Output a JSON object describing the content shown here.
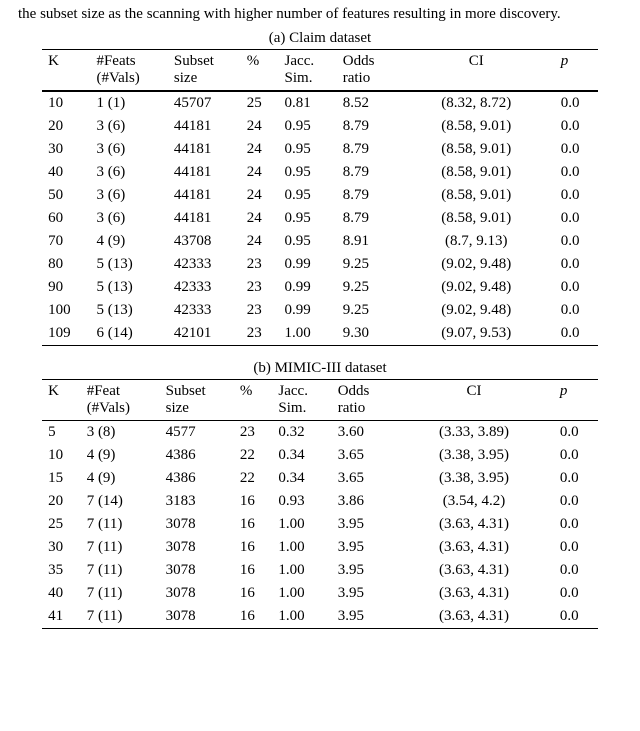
{
  "fragment": "the subset size as the scanning with higher number of features resulting in more discovery.",
  "tableA": {
    "caption": "(a) Claim dataset",
    "headers": {
      "k": "K",
      "feats1": "#Feats",
      "feats2": "(#Vals)",
      "subset1": "Subset",
      "subset2": "size",
      "pct": "%",
      "jacc1": "Jacc.",
      "jacc2": "Sim.",
      "odds1": "Odds",
      "odds2": "ratio",
      "ci": "CI",
      "p": "p"
    },
    "rows": [
      {
        "k": "10",
        "feats": "1 (1)",
        "subset": "45707",
        "pct": "25",
        "jacc": "0.81",
        "odds": "8.52",
        "ci": "(8.32, 8.72)",
        "p": "0.0"
      },
      {
        "k": "20",
        "feats": "3 (6)",
        "subset": "44181",
        "pct": "24",
        "jacc": "0.95",
        "odds": "8.79",
        "ci": "(8.58, 9.01)",
        "p": "0.0"
      },
      {
        "k": "30",
        "feats": "3 (6)",
        "subset": "44181",
        "pct": "24",
        "jacc": "0.95",
        "odds": "8.79",
        "ci": "(8.58, 9.01)",
        "p": "0.0"
      },
      {
        "k": "40",
        "feats": "3 (6)",
        "subset": "44181",
        "pct": "24",
        "jacc": "0.95",
        "odds": "8.79",
        "ci": "(8.58, 9.01)",
        "p": "0.0"
      },
      {
        "k": "50",
        "feats": "3 (6)",
        "subset": "44181",
        "pct": "24",
        "jacc": "0.95",
        "odds": "8.79",
        "ci": "(8.58, 9.01)",
        "p": "0.0"
      },
      {
        "k": "60",
        "feats": "3 (6)",
        "subset": "44181",
        "pct": "24",
        "jacc": "0.95",
        "odds": "8.79",
        "ci": "(8.58, 9.01)",
        "p": "0.0"
      },
      {
        "k": "70",
        "feats": "4 (9)",
        "subset": "43708",
        "pct": "24",
        "jacc": "0.95",
        "odds": "8.91",
        "ci": "(8.7, 9.13)",
        "p": "0.0"
      },
      {
        "k": "80",
        "feats": "5 (13)",
        "subset": "42333",
        "pct": "23",
        "jacc": "0.99",
        "odds": "9.25",
        "ci": "(9.02, 9.48)",
        "p": "0.0"
      },
      {
        "k": "90",
        "feats": "5 (13)",
        "subset": "42333",
        "pct": "23",
        "jacc": "0.99",
        "odds": "9.25",
        "ci": "(9.02, 9.48)",
        "p": "0.0"
      },
      {
        "k": "100",
        "feats": "5 (13)",
        "subset": "42333",
        "pct": "23",
        "jacc": "0.99",
        "odds": "9.25",
        "ci": "(9.02, 9.48)",
        "p": "0.0"
      },
      {
        "k": "109",
        "feats": "6 (14)",
        "subset": "42101",
        "pct": "23",
        "jacc": "1.00",
        "odds": "9.30",
        "ci": "(9.07, 9.53)",
        "p": "0.0"
      }
    ]
  },
  "tableB": {
    "caption": "(b) MIMIC-III dataset",
    "headers": {
      "k": "K",
      "feats1": "#Feat",
      "feats2": "(#Vals)",
      "subset1": "Subset",
      "subset2": "size",
      "pct": "%",
      "jacc1": "Jacc.",
      "jacc2": "Sim.",
      "odds1": "Odds",
      "odds2": "ratio",
      "ci": "CI",
      "p": "p"
    },
    "rows": [
      {
        "k": "5",
        "feats": "3 (8)",
        "subset": "4577",
        "pct": "23",
        "jacc": "0.32",
        "odds": "3.60",
        "ci": "(3.33, 3.89)",
        "p": "0.0"
      },
      {
        "k": "10",
        "feats": "4 (9)",
        "subset": "4386",
        "pct": "22",
        "jacc": "0.34",
        "odds": "3.65",
        "ci": "(3.38, 3.95)",
        "p": "0.0"
      },
      {
        "k": "15",
        "feats": "4 (9)",
        "subset": "4386",
        "pct": "22",
        "jacc": "0.34",
        "odds": "3.65",
        "ci": "(3.38, 3.95)",
        "p": "0.0"
      },
      {
        "k": "20",
        "feats": "7 (14)",
        "subset": "3183",
        "pct": "16",
        "jacc": "0.93",
        "odds": "3.86",
        "ci": "(3.54, 4.2)",
        "p": "0.0"
      },
      {
        "k": "25",
        "feats": "7 (11)",
        "subset": "3078",
        "pct": "16",
        "jacc": "1.00",
        "odds": "3.95",
        "ci": "(3.63, 4.31)",
        "p": "0.0"
      },
      {
        "k": "30",
        "feats": "7 (11)",
        "subset": "3078",
        "pct": "16",
        "jacc": "1.00",
        "odds": "3.95",
        "ci": "(3.63, 4.31)",
        "p": "0.0"
      },
      {
        "k": "35",
        "feats": "7 (11)",
        "subset": "3078",
        "pct": "16",
        "jacc": "1.00",
        "odds": "3.95",
        "ci": "(3.63, 4.31)",
        "p": "0.0"
      },
      {
        "k": "40",
        "feats": "7 (11)",
        "subset": "3078",
        "pct": "16",
        "jacc": "1.00",
        "odds": "3.95",
        "ci": "(3.63, 4.31)",
        "p": "0.0"
      },
      {
        "k": "41",
        "feats": "7 (11)",
        "subset": "3078",
        "pct": "16",
        "jacc": "1.00",
        "odds": "3.95",
        "ci": "(3.63, 4.31)",
        "p": "0.0"
      }
    ]
  },
  "chart_data": [
    {
      "type": "table",
      "title": "(a) Claim dataset",
      "columns": [
        "K",
        "#Feats (#Vals)",
        "Subset size",
        "%",
        "Jacc. Sim.",
        "Odds ratio",
        "CI",
        "p"
      ],
      "rows": [
        [
          10,
          "1 (1)",
          45707,
          25,
          0.81,
          8.52,
          "(8.32, 8.72)",
          0.0
        ],
        [
          20,
          "3 (6)",
          44181,
          24,
          0.95,
          8.79,
          "(8.58, 9.01)",
          0.0
        ],
        [
          30,
          "3 (6)",
          44181,
          24,
          0.95,
          8.79,
          "(8.58, 9.01)",
          0.0
        ],
        [
          40,
          "3 (6)",
          44181,
          24,
          0.95,
          8.79,
          "(8.58, 9.01)",
          0.0
        ],
        [
          50,
          "3 (6)",
          44181,
          24,
          0.95,
          8.79,
          "(8.58, 9.01)",
          0.0
        ],
        [
          60,
          "3 (6)",
          44181,
          24,
          0.95,
          8.79,
          "(8.58, 9.01)",
          0.0
        ],
        [
          70,
          "4 (9)",
          43708,
          24,
          0.95,
          8.91,
          "(8.7, 9.13)",
          0.0
        ],
        [
          80,
          "5 (13)",
          42333,
          23,
          0.99,
          9.25,
          "(9.02, 9.48)",
          0.0
        ],
        [
          90,
          "5 (13)",
          42333,
          23,
          0.99,
          9.25,
          "(9.02, 9.48)",
          0.0
        ],
        [
          100,
          "5 (13)",
          42333,
          23,
          0.99,
          9.25,
          "(9.02, 9.48)",
          0.0
        ],
        [
          109,
          "6 (14)",
          42101,
          23,
          1.0,
          9.3,
          "(9.07, 9.53)",
          0.0
        ]
      ]
    },
    {
      "type": "table",
      "title": "(b) MIMIC-III dataset",
      "columns": [
        "K",
        "#Feat (#Vals)",
        "Subset size",
        "%",
        "Jacc. Sim.",
        "Odds ratio",
        "CI",
        "p"
      ],
      "rows": [
        [
          5,
          "3 (8)",
          4577,
          23,
          0.32,
          3.6,
          "(3.33, 3.89)",
          0.0
        ],
        [
          10,
          "4 (9)",
          4386,
          22,
          0.34,
          3.65,
          "(3.38, 3.95)",
          0.0
        ],
        [
          15,
          "4 (9)",
          4386,
          22,
          0.34,
          3.65,
          "(3.38, 3.95)",
          0.0
        ],
        [
          20,
          "7 (14)",
          3183,
          16,
          0.93,
          3.86,
          "(3.54, 4.2)",
          0.0
        ],
        [
          25,
          "7 (11)",
          3078,
          16,
          1.0,
          3.95,
          "(3.63, 4.31)",
          0.0
        ],
        [
          30,
          "7 (11)",
          3078,
          16,
          1.0,
          3.95,
          "(3.63, 4.31)",
          0.0
        ],
        [
          35,
          "7 (11)",
          3078,
          16,
          1.0,
          3.95,
          "(3.63, 4.31)",
          0.0
        ],
        [
          40,
          "7 (11)",
          3078,
          16,
          1.0,
          3.95,
          "(3.63, 4.31)",
          0.0
        ],
        [
          41,
          "7 (11)",
          3078,
          16,
          1.0,
          3.95,
          "(3.63, 4.31)",
          0.0
        ]
      ]
    }
  ]
}
